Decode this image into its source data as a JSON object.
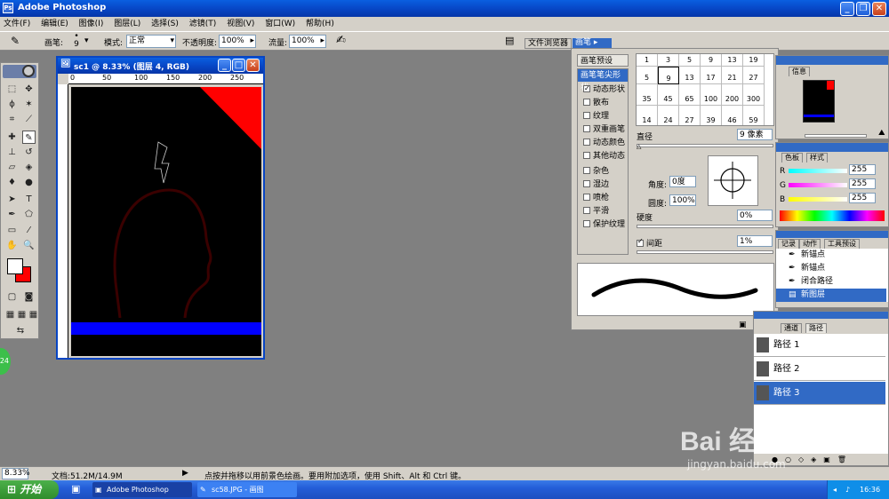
{
  "app": {
    "title": "Adobe Photoshop",
    "window_controls": [
      "minimize-icon",
      "restore-icon",
      "close-icon"
    ]
  },
  "menu": [
    "文件(F)",
    "编辑(E)",
    "图像(I)",
    "图层(L)",
    "选择(S)",
    "滤镜(T)",
    "视图(V)",
    "窗口(W)",
    "帮助(H)"
  ],
  "options": {
    "brush_label": "画笔:",
    "brush_size": "9",
    "mode_label": "模式:",
    "mode_value": "正常",
    "opacity_label": "不透明度:",
    "opacity_value": "100%",
    "flow_label": "流量:",
    "flow_value": "100%",
    "tab_file_browser": "文件浏览器",
    "tab_brushes": "画笔"
  },
  "document": {
    "title": "sc1 @ 8.33% (图层 4, RGB)",
    "ruler_ticks": [
      "0",
      "50",
      "100",
      "150",
      "200",
      "250"
    ],
    "ruler_units": "厘米"
  },
  "brushes_panel": {
    "presets_label": "画笔预设",
    "tip_shape_label": "画笔笔尖形状",
    "options": [
      {
        "label": "动态形状",
        "checked": true
      },
      {
        "label": "散布",
        "checked": false
      },
      {
        "label": "纹理",
        "checked": false
      },
      {
        "label": "双重画笔",
        "checked": false
      },
      {
        "label": "动态颜色",
        "checked": false
      },
      {
        "label": "其他动态",
        "checked": false
      },
      {
        "label": "杂色",
        "checked": false
      },
      {
        "label": "湿边",
        "checked": false
      },
      {
        "label": "喷枪",
        "checked": false
      },
      {
        "label": "平滑",
        "checked": false
      },
      {
        "label": "保护纹理",
        "checked": false
      }
    ],
    "grid": [
      "1",
      "3",
      "5",
      "9",
      "13",
      "19",
      "5",
      "9",
      "13",
      "17",
      "21",
      "27",
      "35",
      "45",
      "65",
      "100",
      "200",
      "300",
      "14",
      "24",
      "27",
      "39",
      "46",
      "59"
    ],
    "diameter_label": "直径",
    "diameter_value": "9 像素",
    "angle_label": "角度:",
    "angle_value": "0度",
    "roundness_label": "圆度:",
    "roundness_value": "100%",
    "hardness_label": "硬度",
    "hardness_value": "0%",
    "spacing_label": "间距",
    "spacing_value": "1%",
    "spacing_checked": true
  },
  "navigator_panel": {
    "tab_info": "信息"
  },
  "color_panel": {
    "tabs": [
      "色板",
      "样式"
    ],
    "channels": [
      {
        "label": "R",
        "value": "255"
      },
      {
        "label": "G",
        "value": "255"
      },
      {
        "label": "B",
        "value": "255"
      }
    ]
  },
  "history_panel": {
    "tabs": [
      "记录",
      "动作",
      "工具预设"
    ],
    "items": [
      "新锚点",
      "新锚点",
      "闭合路径",
      "新图层"
    ]
  },
  "paths_panel": {
    "tabs": [
      "通道",
      "路径"
    ],
    "items": [
      "路径 1",
      "路径 2",
      "路径 3"
    ]
  },
  "status": {
    "zoom": "8.33%",
    "doc": "文档:51.2M/14.9M",
    "hint": "点按并拖移以用前景色绘画。要用附加选项，使用 Shift、Alt 和 Ctrl 键。"
  },
  "taskbar": {
    "start": "开始",
    "tasks": [
      "Adobe Photoshop",
      "sc58.JPG - 画图"
    ],
    "time": "16:36"
  },
  "watermark": {
    "brand": "Bai 经验",
    "url": "jingyan.baidu.com"
  },
  "badge": "24",
  "colors": {
    "foreground": "#ffffff",
    "background": "#ff0000",
    "accent_blue": "#0000ff",
    "xp_blue": "#0745c4"
  }
}
